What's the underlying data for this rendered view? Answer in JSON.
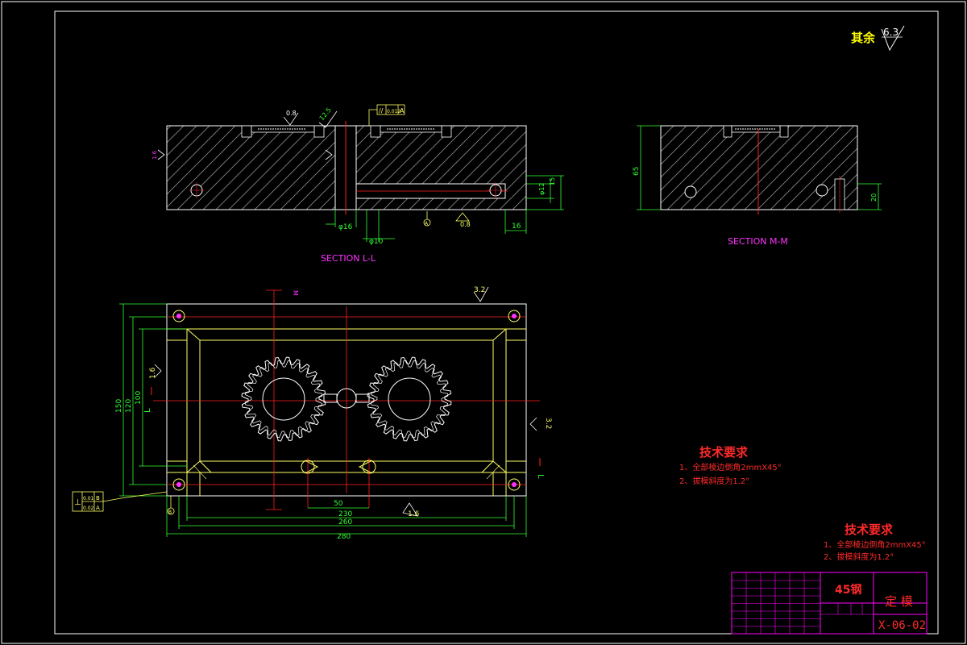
{
  "colors": {
    "background": "#000000",
    "outline": "#ffffff",
    "part": "#ffff66",
    "hatch": "#8a8a8a",
    "center": "#ff2020",
    "dimension": "#33ff33",
    "magenta": "#ff33ff",
    "red_text": "#ff2a2a",
    "title_block": "#ff00ff"
  },
  "surface_finish": {
    "label": "其余",
    "value": "6.3"
  },
  "section_ll": {
    "title": "SECTION L-L",
    "roughness_top_left": "0.8",
    "roughness_top_mid": "12.5",
    "fcf_symbol": "//",
    "fcf_tolerance": "0.012",
    "fcf_datum": "A",
    "roughness_side": "1.6",
    "roughness_bottom": "0.8",
    "dim_bore": "φ16",
    "dim_pin": "φ10",
    "dim_right_hole": "φ12",
    "dim_depth": "15",
    "dim_right_offset": "16",
    "datum_letter": "A"
  },
  "section_mm": {
    "title": "SECTION M-M",
    "dim_height": "65",
    "dim_depth": "20"
  },
  "plan_view": {
    "roughness_top": "3.2",
    "roughness_right": "3.2",
    "roughness_left": "1.6",
    "roughness_bottom": "1.6",
    "dim_total_height": "150",
    "dim_inner_height": "100",
    "dim_slot_height": "120",
    "dim_50": "50",
    "dim_230": "230",
    "dim_260": "260",
    "dim_280": "280",
    "section_mark_m": "M",
    "section_mark_l": "L",
    "fcf_perp_symbol": "⊥",
    "fcf_perp_value_1": "0.01",
    "fcf_perp_datum_1": "B",
    "fcf_perp_value_2": "0.02",
    "fcf_perp_datum_2": "A",
    "datum_letter": "B"
  },
  "tech_req_1": {
    "title": "技术要求",
    "line1": "1、全部棱边倒角2mmX45°",
    "line2": "2、拔模斜度为1.2°"
  },
  "tech_req_2": {
    "title": "技术要求",
    "line1": "1、全部棱边倒角2mmX45°",
    "line2": "2、拔模斜度为1.2°"
  },
  "title_block": {
    "material": "45钢",
    "part_name": "定 模",
    "drawing_number": "X-06-02"
  }
}
